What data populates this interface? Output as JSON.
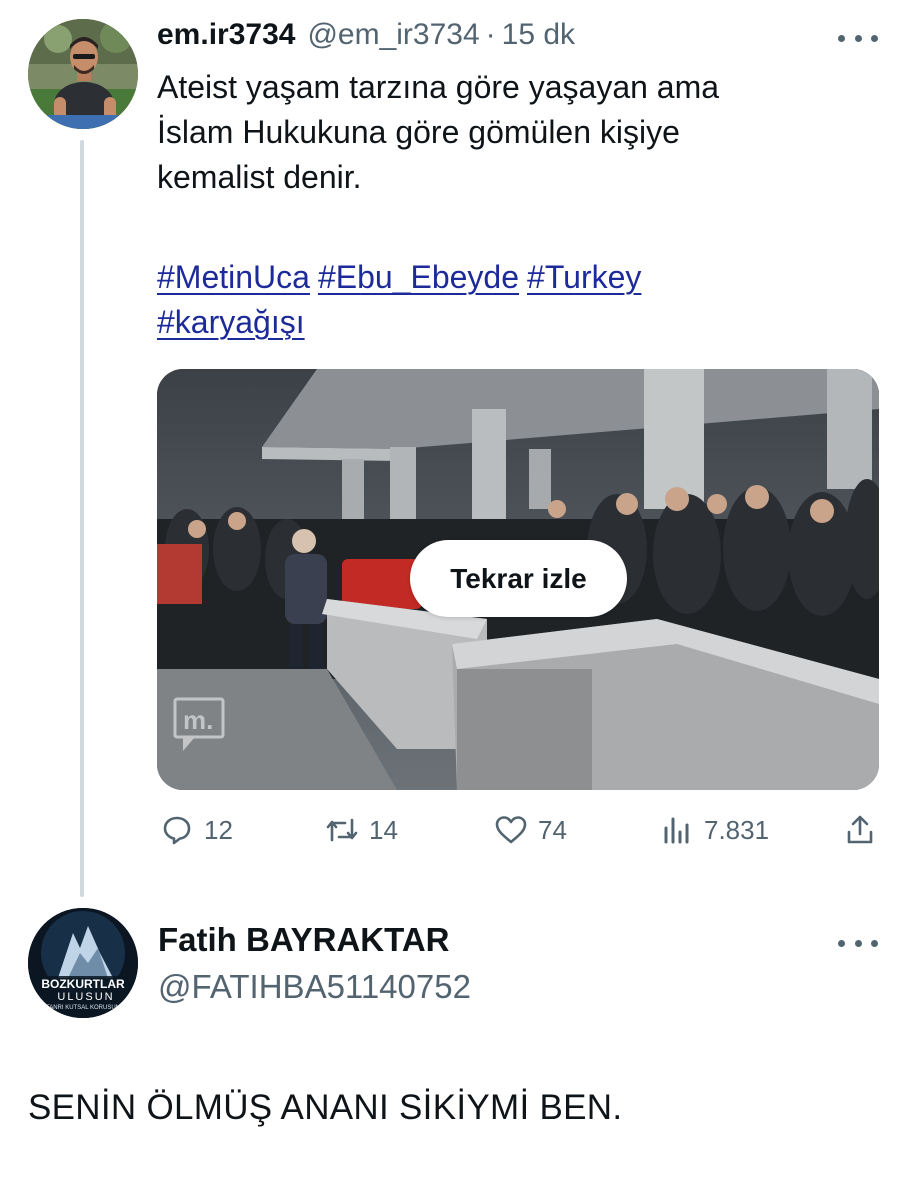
{
  "tweet1": {
    "display_name": "em.ir3734",
    "handle": "@em_ir3734",
    "separator": "·",
    "time": "15 dk",
    "text_lines": [
      "Ateist yaşam tarzına göre yaşayan ama",
      "İslam Hukukuna göre gömülen kişiye",
      "kemalist denir."
    ],
    "hashtags": [
      "#MetinUca",
      "#Ebu_Ebeyde",
      "#Turkey",
      "#karyağışı"
    ],
    "media": {
      "replay_label": "Tekrar izle",
      "watermark": "m."
    },
    "actions": {
      "reply_count": "12",
      "retweet_count": "14",
      "like_count": "74",
      "views_count": "7.831"
    }
  },
  "tweet2": {
    "display_name": "Fatih BAYRAKTAR",
    "handle": "@FATIHBA51140752",
    "avatar_text": [
      "BOZKURTLAR",
      "ULUSUN",
      "TANRI KUTSAL KORUSUN"
    ],
    "text": "SENİN ÖLMÜŞ ANANI SİKİYMİ BEN."
  },
  "colors": {
    "text_primary": "#0f1419",
    "text_secondary": "#536471",
    "hashtag": "#1d2a99",
    "thread_line": "#cfd9de"
  },
  "icons": [
    "more-icon",
    "reply-icon",
    "retweet-icon",
    "like-icon",
    "views-icon",
    "share-icon"
  ]
}
